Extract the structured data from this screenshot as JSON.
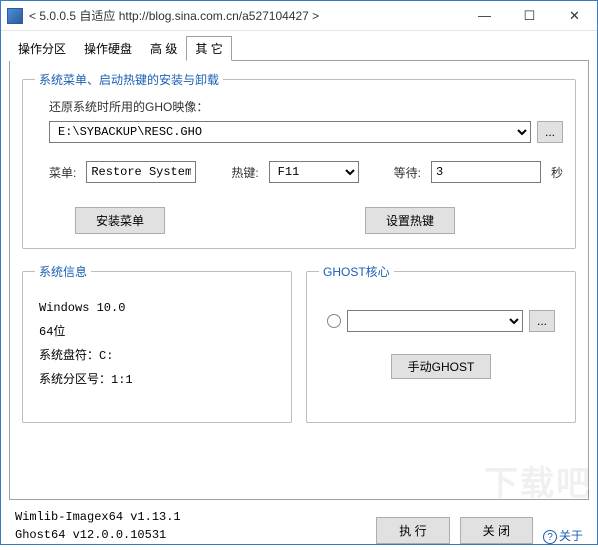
{
  "window": {
    "title": "< 5.0.0.5 自适应 http://blog.sina.com.cn/a527104427 >"
  },
  "tabs": {
    "t0": "操作分区",
    "t1": "操作硬盘",
    "t2": "高 级",
    "t3": "其 它"
  },
  "group_install": {
    "legend": "系统菜单、启动热键的安装与卸载",
    "gho_label": "还原系统时所用的GHO映像：",
    "gho_path": "E:\\SYBACKUP\\RESC.GHO",
    "browse": "...",
    "menu_label": "菜单:",
    "menu_value": "Restore System",
    "hotkey_label": "热键:",
    "hotkey_value": "F11",
    "wait_label": "等待:",
    "wait_value": "3",
    "wait_sec": "秒",
    "btn_install_menu": "安装菜单",
    "btn_set_hotkey": "设置热键"
  },
  "group_sysinfo": {
    "legend": "系统信息",
    "os": "Windows 10.0",
    "arch": "64位",
    "sysdrive_label": "系统盘符：",
    "sysdrive": "C:",
    "syspart_label": "系统分区号：",
    "syspart": "1:1"
  },
  "group_ghost": {
    "legend": "GHOST核心",
    "browse": "...",
    "btn_manual": "手动GHOST"
  },
  "footer": {
    "line1": "Wimlib-Imagex64 v1.13.1",
    "line2": "Ghost64 v12.0.0.10531",
    "btn_exec": "执 行",
    "btn_close": "关 闭",
    "about": "关于"
  },
  "watermark": "下载吧"
}
